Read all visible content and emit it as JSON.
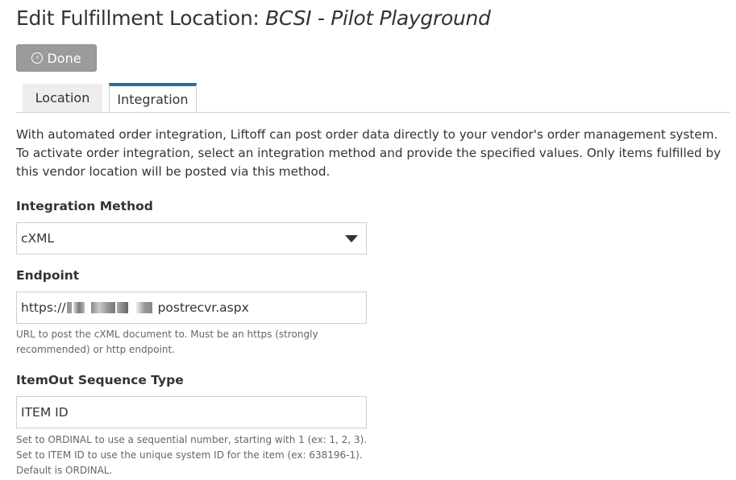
{
  "header": {
    "title_prefix": "Edit Fulfillment Location: ",
    "title_name": "BCSI - Pilot Playground"
  },
  "done_button": {
    "icon": "chevron-left-circle-icon",
    "icon_glyph": "‹",
    "label": "Done"
  },
  "tabs": [
    {
      "label": "Location",
      "active": false
    },
    {
      "label": "Integration",
      "active": true
    }
  ],
  "colors": {
    "active_tab_accent": "#1f6fa3",
    "done_button_bg": "#9b9b9b"
  },
  "intro_text": "With automated order integration, Liftoff can post order data directly to your vendor's order management system. To activate order integration, select an integration method and provide the specified values. Only items fulfilled by this vendor location will be posted via this method.",
  "form": {
    "integration_method": {
      "label": "Integration Method",
      "value": "cXML"
    },
    "endpoint": {
      "label": "Endpoint",
      "value_prefix": "https://",
      "value_suffix": "postrecvr.aspx",
      "help": "URL to post the cXML document to. Must be an https (strongly recommended) or http endpoint."
    },
    "itemout_sequence": {
      "label": "ItemOut Sequence Type",
      "value": "ITEM ID",
      "help_lines": [
        "Set to ORDINAL to use a sequential number, starting with 1 (ex: 1, 2, 3).",
        "Set to ITEM ID to use the unique system ID for the item (ex: 638196-1).",
        "Default is ORDINAL."
      ]
    }
  }
}
